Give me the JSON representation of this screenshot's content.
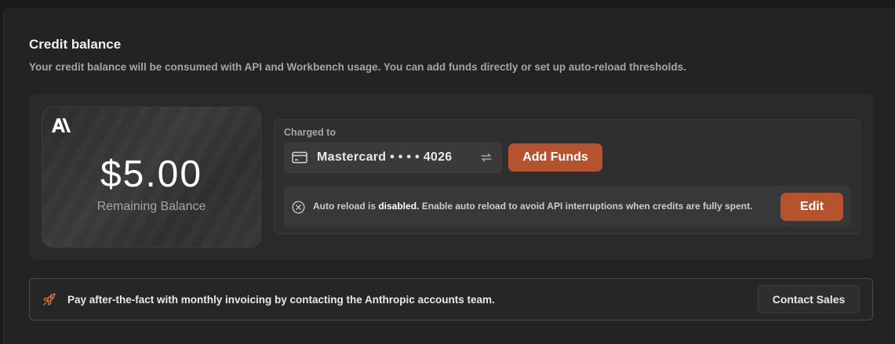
{
  "section": {
    "title": "Credit balance",
    "subtitle": "Your credit balance will be consumed with API and Workbench usage. You can add funds directly or set up auto-reload thresholds."
  },
  "balance_card": {
    "logo": "anthropic-logo",
    "amount": "$5.00",
    "label": "Remaining Balance"
  },
  "payment": {
    "charged_to_label": "Charged to",
    "card_icon": "credit-card-icon",
    "card_text": "Mastercard • • • • 4026",
    "swap_icon": "swap-icon",
    "add_funds_label": "Add Funds"
  },
  "auto_reload": {
    "icon": "x-circle-icon",
    "prefix": "Auto reload is ",
    "status": "disabled.",
    "suffix": " Enable auto reload to avoid API interruptions when credits are fully spent.",
    "edit_label": "Edit"
  },
  "invoicing": {
    "icon": "rocket-icon",
    "text": "Pay after-the-fact with monthly invoicing by contacting the Anthropic accounts team.",
    "contact_label": "Contact Sales"
  },
  "colors": {
    "accent": "#b5532e",
    "background": "#1a1a1a",
    "panel": "#232323"
  }
}
